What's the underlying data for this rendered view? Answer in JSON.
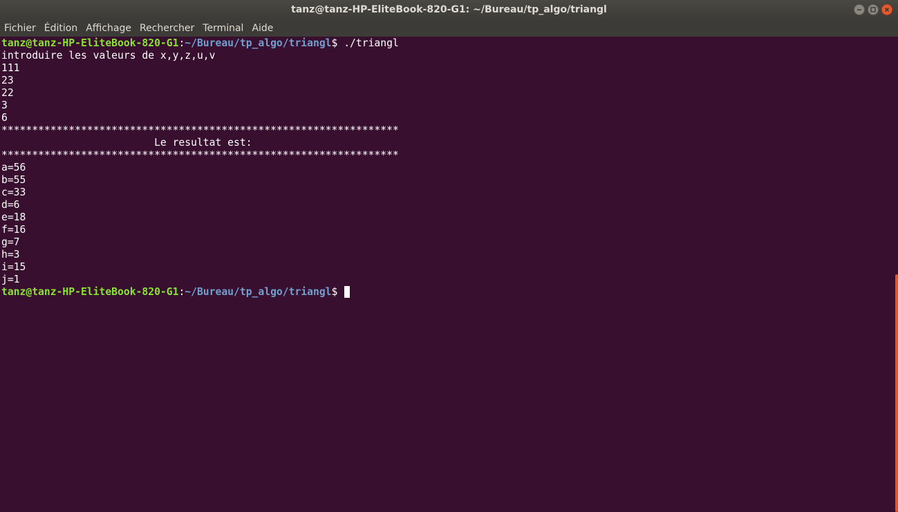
{
  "window": {
    "title": "tanz@tanz-HP-EliteBook-820-G1: ~/Bureau/tp_algo/triangl"
  },
  "menu": {
    "items": [
      "Fichier",
      "Édition",
      "Affichage",
      "Rechercher",
      "Terminal",
      "Aide"
    ]
  },
  "terminal": {
    "prompt_user": "tanz@tanz-HP-EliteBook-820-G1",
    "prompt_sep": ":",
    "prompt_path": "~/Bureau/tp_algo/triangl",
    "prompt_dollar": "$ ",
    "command": "./triangl",
    "output": [
      "introduire les valeurs de x,y,z,u,v",
      "111",
      "23",
      "22",
      "3",
      "6",
      "*****************************************************************",
      "                         Le resultat est:",
      "*****************************************************************",
      "a=56",
      "b=55",
      "c=33",
      "d=6",
      "e=18",
      "f=16",
      "g=7",
      "h=3",
      "i=15",
      "j=1"
    ]
  },
  "colors": {
    "background": "#380f2f",
    "prompt_user": "#8ae234",
    "prompt_path": "#729fcf",
    "scroll_thumb": "#e95420"
  },
  "icons": {
    "minimize": "minimize-icon",
    "maximize": "maximize-icon",
    "close": "close-icon"
  }
}
